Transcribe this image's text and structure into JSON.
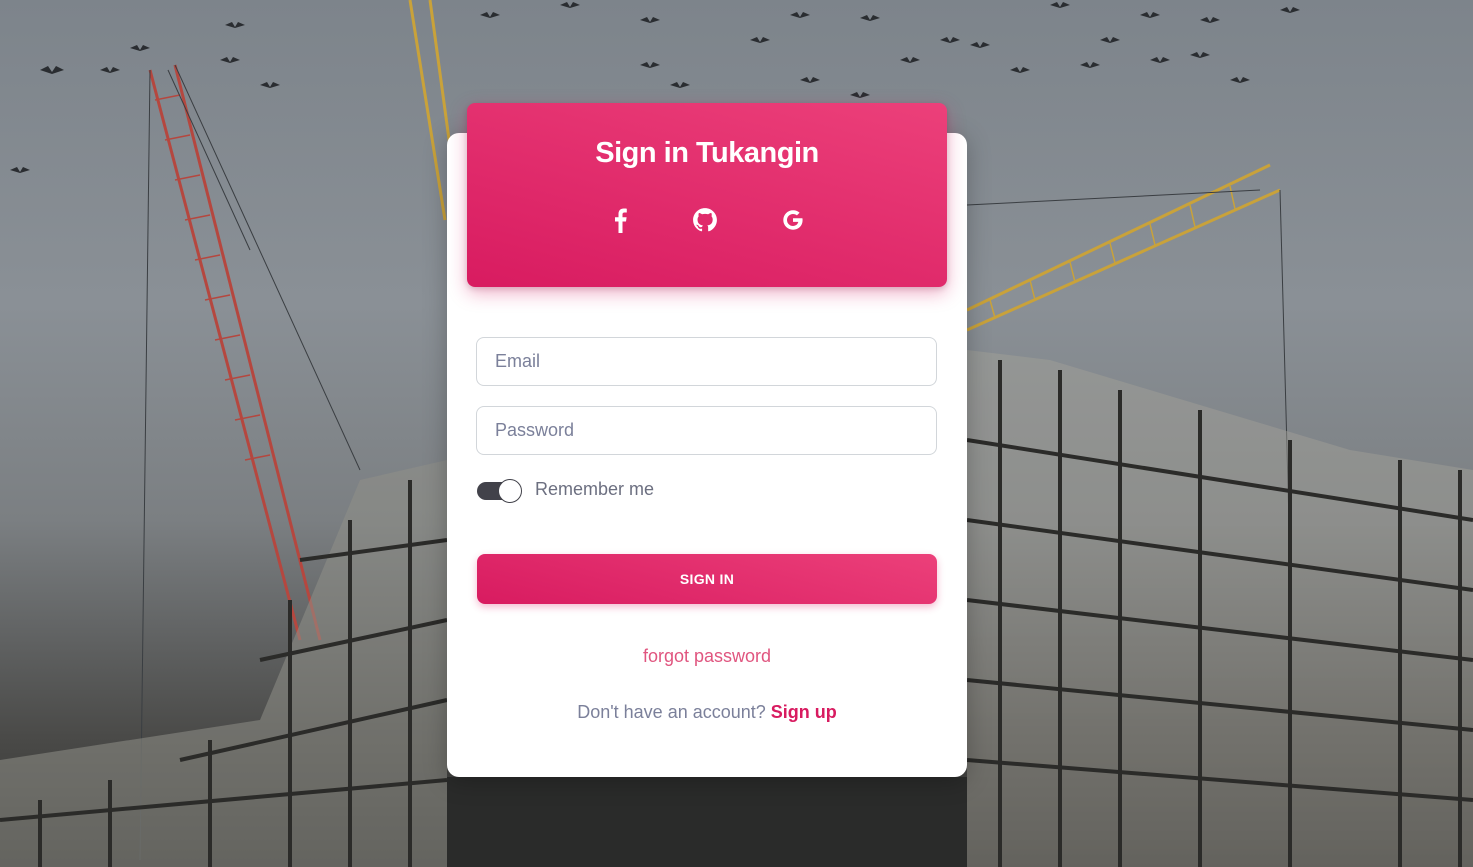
{
  "header": {
    "title": "Sign in Tukangin",
    "social": [
      "facebook-icon",
      "github-icon",
      "google-icon"
    ]
  },
  "form": {
    "email_placeholder": "Email",
    "password_placeholder": "Password",
    "remember_label": "Remember me",
    "remember_checked": true,
    "submit_label": "SIGN IN"
  },
  "links": {
    "forgot_password": "forgot password",
    "no_account_text": "Don't have an account?",
    "signup_label": "Sign up"
  },
  "colors": {
    "accent": "#d81b60",
    "accent_light": "#ec407a",
    "card": "#ffffff"
  }
}
